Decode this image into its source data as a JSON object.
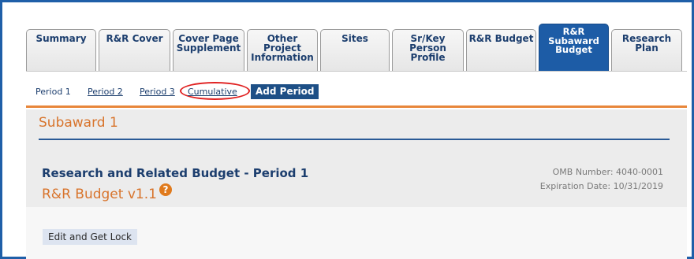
{
  "tabs": [
    {
      "label": "Summary"
    },
    {
      "label": "R&R Cover"
    },
    {
      "label": "Cover Page\nSupplement"
    },
    {
      "label": "Other\nProject\nInformation"
    },
    {
      "label": "Sites"
    },
    {
      "label": "Sr/Key\nPerson\nProfile"
    },
    {
      "label": "R&R Budget"
    },
    {
      "label": "R&R\nSubaward\nBudget"
    },
    {
      "label": "Research\nPlan"
    }
  ],
  "active_tab": "R&R Subaward Budget",
  "periods": {
    "period1": "Period 1",
    "period2": "Period 2",
    "period3": "Period 3",
    "cumulative": "Cumulative",
    "add_period": "Add Period"
  },
  "subaward": {
    "title": "Subaward 1"
  },
  "form": {
    "title": "Research and Related Budget - Period 1",
    "version": "R&R Budget v1.1",
    "omb_number": "OMB Number: 4040-0001",
    "expiration": "Expiration Date: 10/31/2019"
  },
  "lock": {
    "label": "Edit and Get Lock"
  },
  "colors": {
    "frame": "#1f5fa8",
    "active_tab": "#1d5ca6",
    "accent_orange": "#e8863a",
    "title_orange": "#d8742c",
    "navy_text": "#1c3e6e",
    "highlight": "#e02020"
  }
}
